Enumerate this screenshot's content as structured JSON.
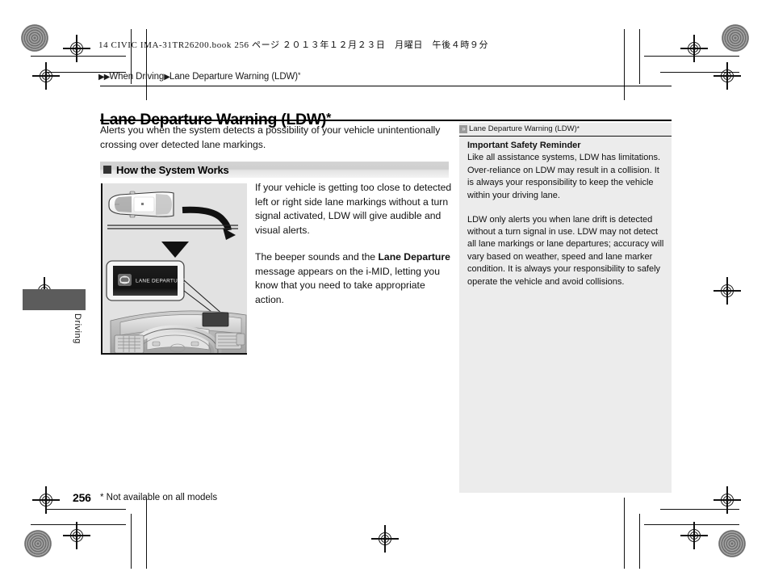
{
  "print_header": {
    "text": "14 CIVIC IMA-31TR26200.book  256 ページ  ２０１３年１２月２３日　月曜日　午後４時９分"
  },
  "breadcrumb": {
    "arrow1": "▶▶",
    "section": "When Driving",
    "arrow2": "▶",
    "topic": "Lane Departure Warning (LDW)",
    "asterisk": "*"
  },
  "page_title": {
    "text": "Lane Departure Warning (LDW)",
    "asterisk": "*"
  },
  "intro": {
    "text": "Alerts you when the system detects a possibility of your vehicle unintentionally crossing over detected lane markings."
  },
  "section": {
    "bullet_icon": "filled-square-icon",
    "heading": "How the System Works"
  },
  "body": {
    "paragraph1": "If your vehicle is getting too close to detected left or right side lane markings without a turn signal activated, LDW will give audible and visual alerts.",
    "paragraph2_before": "The beeper sounds and the ",
    "paragraph2_bold": "Lane Departure",
    "paragraph2_after": " message appears on the i-MID, letting you know that you need to take appropriate action."
  },
  "illustration": {
    "name": "ldw-system-illustration",
    "imid_message": "LANE DEPARTURE",
    "imid_icon": "lane-departure-icon",
    "drift_arrow": "curved-drift-arrow",
    "flow_arrow": "down-triangle-arrow"
  },
  "sidebar": {
    "header_icon": "double-chevron-icon",
    "header_title": "Lane Departure Warning (LDW)",
    "header_asterisk": "*",
    "safety_heading": "Important Safety Reminder",
    "safety_paragraph1": "Like all assistance systems, LDW has limitations. Over-reliance on LDW may result in a collision. It is always your responsibility to keep the vehicle within your driving lane.",
    "safety_paragraph2": "LDW only alerts you when lane drift is detected without a turn signal in use. LDW may not detect all lane markings or lane departures; accuracy will vary based on weather, speed and lane marker condition. It is always your responsibility to safely operate the vehicle and avoid collisions."
  },
  "side_tab": {
    "label": "Driving"
  },
  "footer": {
    "page_number": "256",
    "footnote": "* Not available on all models"
  },
  "colors": {
    "panel_gray": "#ececec",
    "illustration_gray": "#e2e2e2",
    "tab_dark": "#5c5c5c",
    "bar_gray": "#d4d4d4"
  }
}
